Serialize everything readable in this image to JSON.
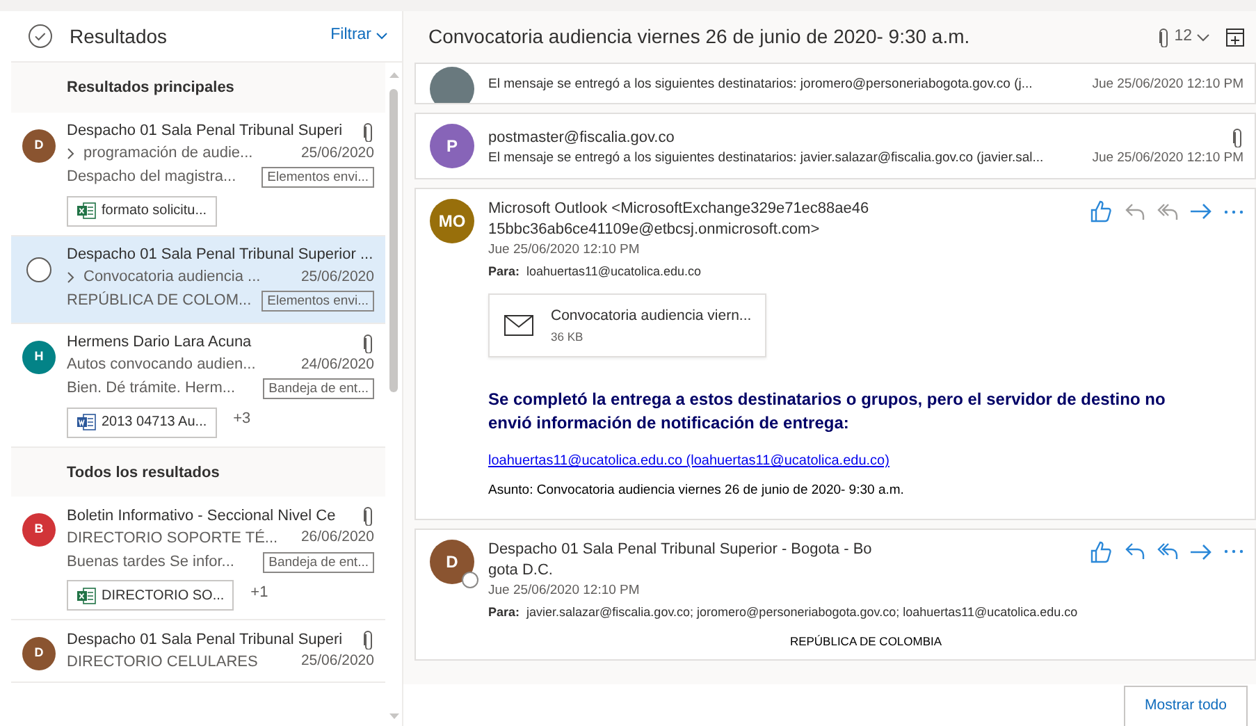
{
  "results": {
    "title": "Resultados",
    "filter": "Filtrar"
  },
  "groups": [
    {
      "heading": "Resultados principales",
      "messages": [
        {
          "avatar": "D",
          "color": "#8a5430",
          "sender": "Despacho 01 Sala Penal Tribunal Superi",
          "clip": true,
          "thread": true,
          "subject": "programación de audie...",
          "date": "25/06/2020",
          "preview": "Despacho del magistra...",
          "folder": "Elementos envi...",
          "attachment": {
            "kind": "excel",
            "name": "formato solicitu..."
          },
          "selected": false
        },
        {
          "sender": "Despacho 01 Sala Penal Tribunal Superior ...",
          "clip": false,
          "thread": true,
          "subject": "Convocatoria audiencia ...",
          "date": "25/06/2020",
          "preview": "REPÚBLICA DE COLOM...",
          "folder": "Elementos envi...",
          "selected": true
        },
        {
          "avatar": "H",
          "color": "#038387",
          "sender": "Hermens Dario Lara Acuna",
          "clip": true,
          "thread": false,
          "subject": "Autos convocando audien...",
          "date": "24/06/2020",
          "preview": "Bien. Dé trámite. Herm...",
          "folder": "Bandeja de ent...",
          "attachment": {
            "kind": "word",
            "name": "2013 04713 Au..."
          },
          "more": "+3",
          "selected": false
        }
      ]
    },
    {
      "heading": "Todos los resultados",
      "messages": [
        {
          "avatar": "B",
          "color": "#d13438",
          "sender": "Boletin Informativo - Seccional Nivel Ce",
          "clip": true,
          "thread": false,
          "subject": "DIRECTORIO SOPORTE TÉ...",
          "date": "26/06/2020",
          "preview": "Buenas tardes Se infor...",
          "folder": "Bandeja de ent...",
          "attachment": {
            "kind": "excel",
            "name": "DIRECTORIO SO..."
          },
          "more": "+1",
          "selected": false
        },
        {
          "avatar": "D",
          "color": "#8a5430",
          "sender": "Despacho 01 Sala Penal Tribunal Superi",
          "clip": true,
          "thread": false,
          "subject": "DIRECTORIO CELULARES",
          "date": "25/06/2020",
          "selected": false
        }
      ]
    }
  ],
  "conversation": {
    "title": "Convocatoria audiencia viernes 26 de junio de 2020- 9:30 a.m.",
    "count": "12",
    "messages": [
      {
        "kind": "cut",
        "color": "#69797e",
        "preview": "El mensaje se entregó a los siguientes destinatarios: joromero@personeriabogota.gov.co (j...",
        "date": "Jue 25/06/2020 12:10 PM"
      },
      {
        "kind": "collapsed",
        "avatar": "P",
        "color": "#8764b8",
        "sender": "postmaster@fiscalia.gov.co",
        "preview": "El mensaje se entregó a los siguientes destinatarios: javier.salazar@fiscalia.gov.co (javier.sal...",
        "date": "Jue 25/06/2020 12:10 PM",
        "clip": true
      },
      {
        "kind": "expanded",
        "avatar": "MO",
        "color": "#986f0b",
        "sender": "Microsoft Outlook <MicrosoftExchange329e71ec88ae46 15bbc36ab6ce41109e@etbcsj.onmicrosoft.com>",
        "date": "Jue 25/06/2020 12:10 PM",
        "to_label": "Para:",
        "to": "loahuertas11@ucatolica.edu.co",
        "presence": false,
        "actions": [
          {
            "kind": "like",
            "disabled": false
          },
          {
            "kind": "reply",
            "disabled": true
          },
          {
            "kind": "reply-all",
            "disabled": true
          },
          {
            "kind": "forward",
            "disabled": false
          },
          {
            "kind": "more",
            "disabled": false
          }
        ],
        "attachment": {
          "name": "Convocatoria audiencia viern...",
          "size": "36 KB"
        },
        "body": [
          {
            "kind": "heading",
            "text": "Se completó la entrega a estos destinatarios o grupos, pero el servidor de destino no envió información de notificación de entrega:"
          },
          {
            "kind": "link",
            "text": "loahuertas11@ucatolica.edu.co (loahuertas11@ucatolica.edu.co)"
          },
          {
            "kind": "text",
            "text": "Asunto: Convocatoria audiencia viernes 26 de junio de 2020- 9:30 a.m."
          }
        ]
      },
      {
        "kind": "expanded",
        "avatar": "D",
        "color": "#8a5430",
        "sender": "Despacho 01 Sala Penal Tribunal Superior - Bogota - Bo gota D.C.",
        "date": "Jue 25/06/2020 12:10 PM",
        "to_label": "Para:",
        "to": "javier.salazar@fiscalia.gov.co; joromero@personeriabogota.gov.co; loahuertas11@ucatolica.edu.co",
        "presence": true,
        "actions": [
          {
            "kind": "like",
            "disabled": false
          },
          {
            "kind": "reply",
            "disabled": false
          },
          {
            "kind": "reply-all",
            "disabled": false
          },
          {
            "kind": "forward",
            "disabled": false
          },
          {
            "kind": "more",
            "disabled": false
          }
        ],
        "body": [
          {
            "kind": "center",
            "text": "REPÚBLICA DE COLOMBIA"
          }
        ]
      }
    ],
    "show_all": "Mostrar todo"
  }
}
